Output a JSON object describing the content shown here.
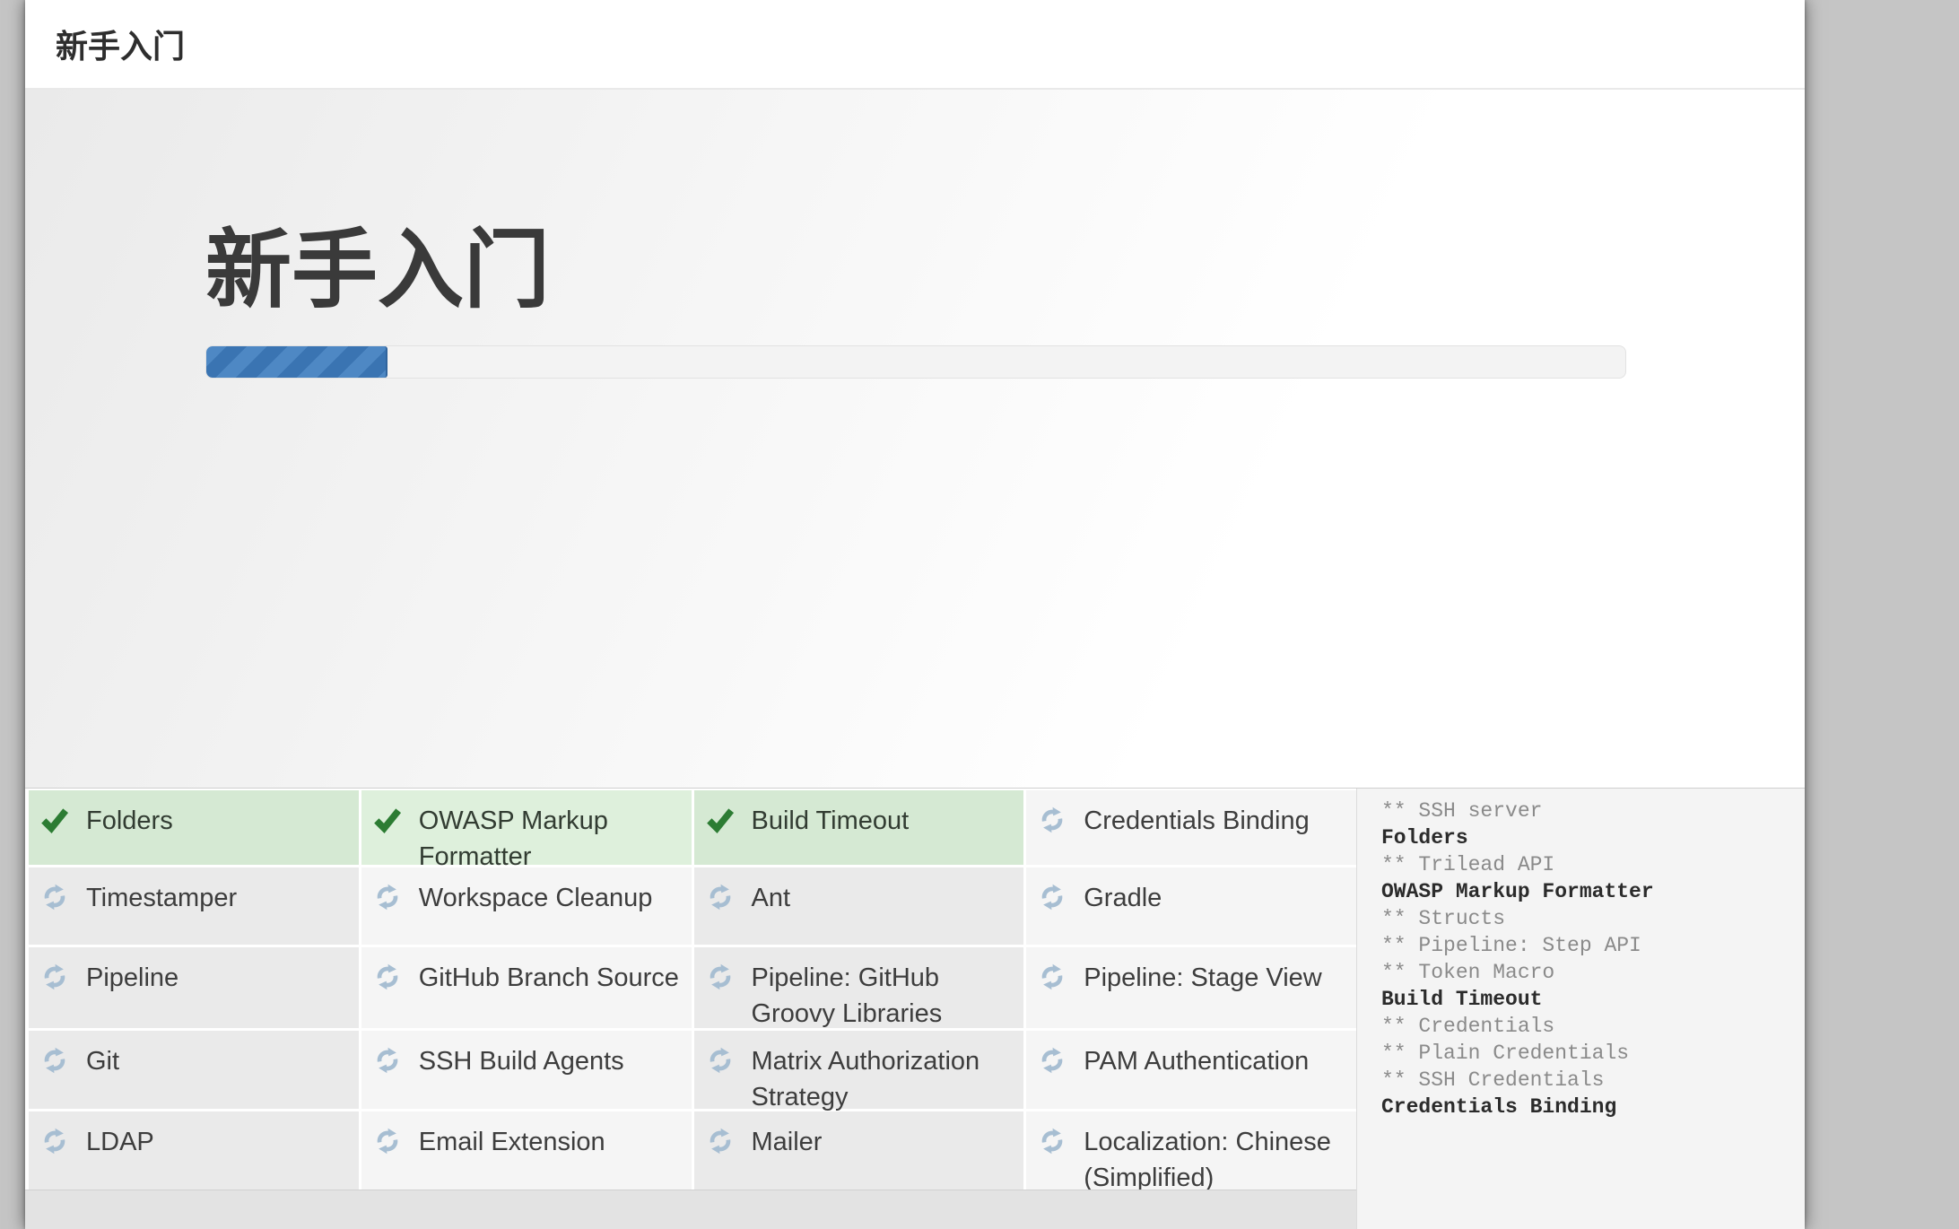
{
  "window": {
    "title": "新手入门"
  },
  "hero": {
    "heading": "新手入门",
    "progress_percent": 12.8
  },
  "plugins": {
    "rows": [
      [
        {
          "name": "Folders",
          "status": "success"
        },
        {
          "name": "OWASP Markup Formatter",
          "status": "success"
        },
        {
          "name": "Build Timeout",
          "status": "success"
        },
        {
          "name": "Credentials Binding",
          "status": "installing"
        }
      ],
      [
        {
          "name": "Timestamper",
          "status": "installing"
        },
        {
          "name": "Workspace Cleanup",
          "status": "installing"
        },
        {
          "name": "Ant",
          "status": "installing"
        },
        {
          "name": "Gradle",
          "status": "installing"
        }
      ],
      [
        {
          "name": "Pipeline",
          "status": "installing"
        },
        {
          "name": "GitHub Branch Source",
          "status": "installing"
        },
        {
          "name": "Pipeline: GitHub Groovy Libraries",
          "status": "installing"
        },
        {
          "name": "Pipeline: Stage View",
          "status": "installing"
        }
      ],
      [
        {
          "name": "Git",
          "status": "installing"
        },
        {
          "name": "SSH Build Agents",
          "status": "installing"
        },
        {
          "name": "Matrix Authorization Strategy",
          "status": "installing"
        },
        {
          "name": "PAM Authentication",
          "status": "installing"
        }
      ],
      [
        {
          "name": "LDAP",
          "status": "installing"
        },
        {
          "name": "Email Extension",
          "status": "installing"
        },
        {
          "name": "Mailer",
          "status": "installing"
        },
        {
          "name": "Localization: Chinese (Simplified)",
          "status": "installing"
        }
      ]
    ]
  },
  "log": {
    "lines": [
      {
        "text": "** SSH server",
        "level": "dim"
      },
      {
        "text": "Folders",
        "level": "done"
      },
      {
        "text": "** Trilead API",
        "level": "dim"
      },
      {
        "text": "OWASP Markup Formatter",
        "level": "done"
      },
      {
        "text": "** Structs",
        "level": "dim"
      },
      {
        "text": "** Pipeline: Step API",
        "level": "dim"
      },
      {
        "text": "** Token Macro",
        "level": "dim"
      },
      {
        "text": "Build Timeout",
        "level": "done"
      },
      {
        "text": "** Credentials",
        "level": "dim"
      },
      {
        "text": "** Plain Credentials",
        "level": "dim"
      },
      {
        "text": "** SSH Credentials",
        "level": "dim"
      },
      {
        "text": "Credentials Binding",
        "level": "done"
      }
    ]
  },
  "icons": {
    "success": "check-icon",
    "installing": "refresh-icon"
  },
  "colors": {
    "page_background": "#c5c5c5",
    "dialog_background": "#ffffff",
    "titlebar_border": "#e9e9e9",
    "hero_gradient_start": "#eaeaea",
    "progress_track": "#f3f3f3",
    "progress_track_border": "#e2e2e2",
    "progress_blue_light": "#4e88c4",
    "progress_blue_dark": "#3a74b2",
    "cell_gray": "#eaeaea",
    "cell_light_gray": "#f5f5f5",
    "cell_success_gray": "#d5e9d3",
    "cell_success_light": "#def0dc",
    "check_green": "#2c7c33",
    "spinner_blue": "#a7bed2",
    "footer_background": "#e3e3e3",
    "log_background": "#f4f4f4",
    "log_dim_text": "#8a8a8a",
    "log_done_text": "#2b2b2b"
  }
}
